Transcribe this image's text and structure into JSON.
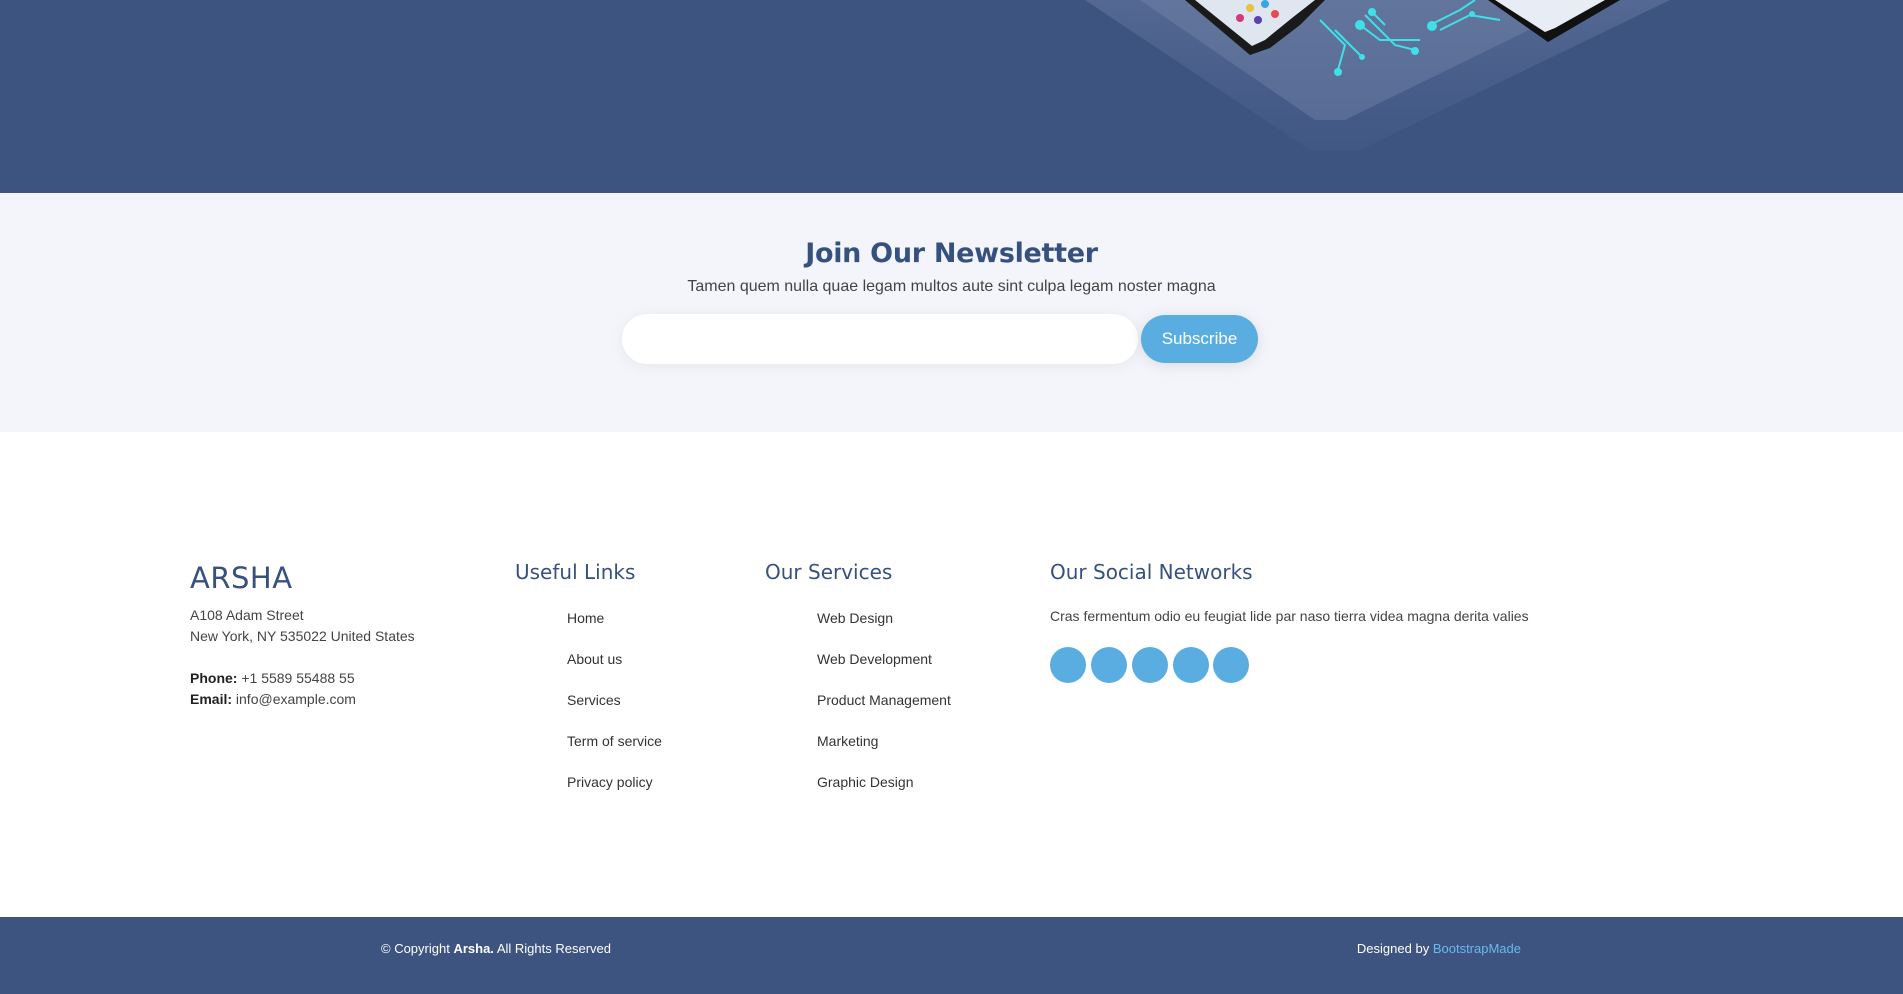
{
  "newsletter": {
    "title": "Join Our Newsletter",
    "subtitle": "Tamen quem nulla quae legam multos aute sint culpa legam noster magna",
    "email_placeholder": "",
    "subscribe_label": "Subscribe"
  },
  "footer": {
    "brand": "ARSHA",
    "address_line1": "A108 Adam Street",
    "address_line2": "New York, NY 535022 United States",
    "phone_label": "Phone:",
    "phone_value": "+1 5589 55488 55",
    "email_label": "Email:",
    "email_value": "info@example.com",
    "useful_links_title": "Useful Links",
    "useful_links": [
      "Home",
      "About us",
      "Services",
      "Term of service",
      "Privacy policy"
    ],
    "services_title": "Our Services",
    "services": [
      "Web Design",
      "Web Development",
      "Product Management",
      "Marketing",
      "Graphic Design"
    ],
    "social_title": "Our Social Networks",
    "social_desc": "Cras fermentum odio eu feugiat lide par naso tierra videa magna derita valies",
    "social_icons": [
      "twitter-icon",
      "facebook-icon",
      "instagram-icon",
      "skype-icon",
      "linkedin-icon"
    ]
  },
  "bottom": {
    "copyright_prefix": "© Copyright",
    "copyright_brand": "Arsha.",
    "copyright_suffix": "All Rights Reserved",
    "designed_by": "Designed by",
    "designer": "BootstrapMade"
  },
  "colors": {
    "brand_blue": "#37517e",
    "accent": "#47b2e4",
    "hero_bg": "#3d5380"
  }
}
